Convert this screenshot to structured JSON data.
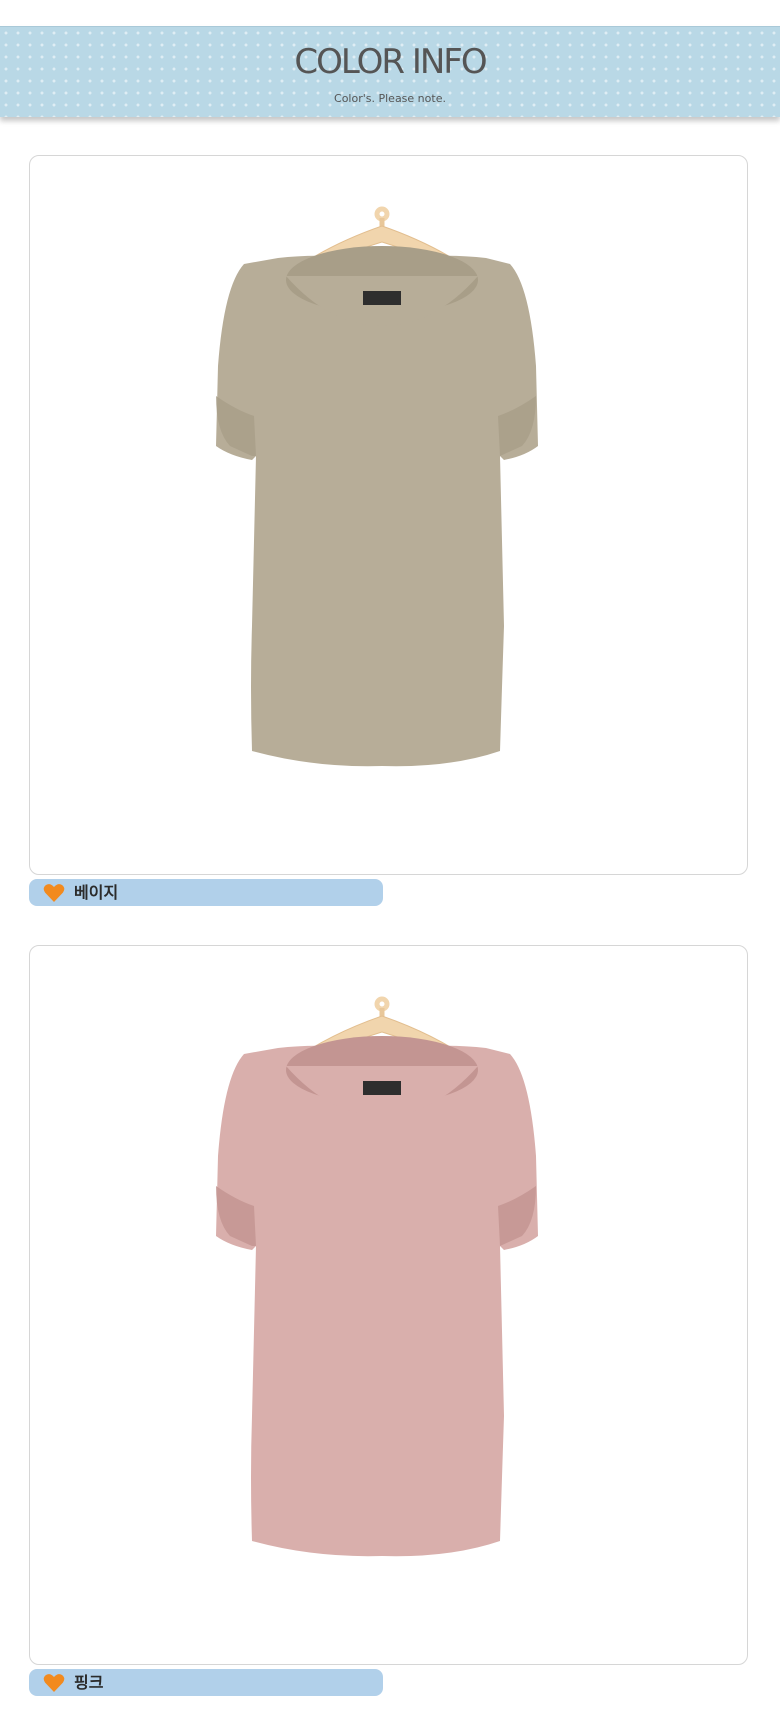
{
  "header": {
    "title": "COLOR INFO",
    "subtitle": "Color's. Please note."
  },
  "products": [
    {
      "color_name": "베이지",
      "shirt_color": "#b7ad98",
      "shirt_shade": "#a89e88",
      "icon": "heart-icon"
    },
    {
      "color_name": "핑크",
      "shirt_color": "#d9afac",
      "shirt_shade": "#c39592",
      "icon": "heart-icon"
    }
  ],
  "colors": {
    "banner": "#b9d8e6",
    "label_bar": "#b1d0ea",
    "heart": "#f28a1e",
    "hanger": "#f1d5ad"
  }
}
